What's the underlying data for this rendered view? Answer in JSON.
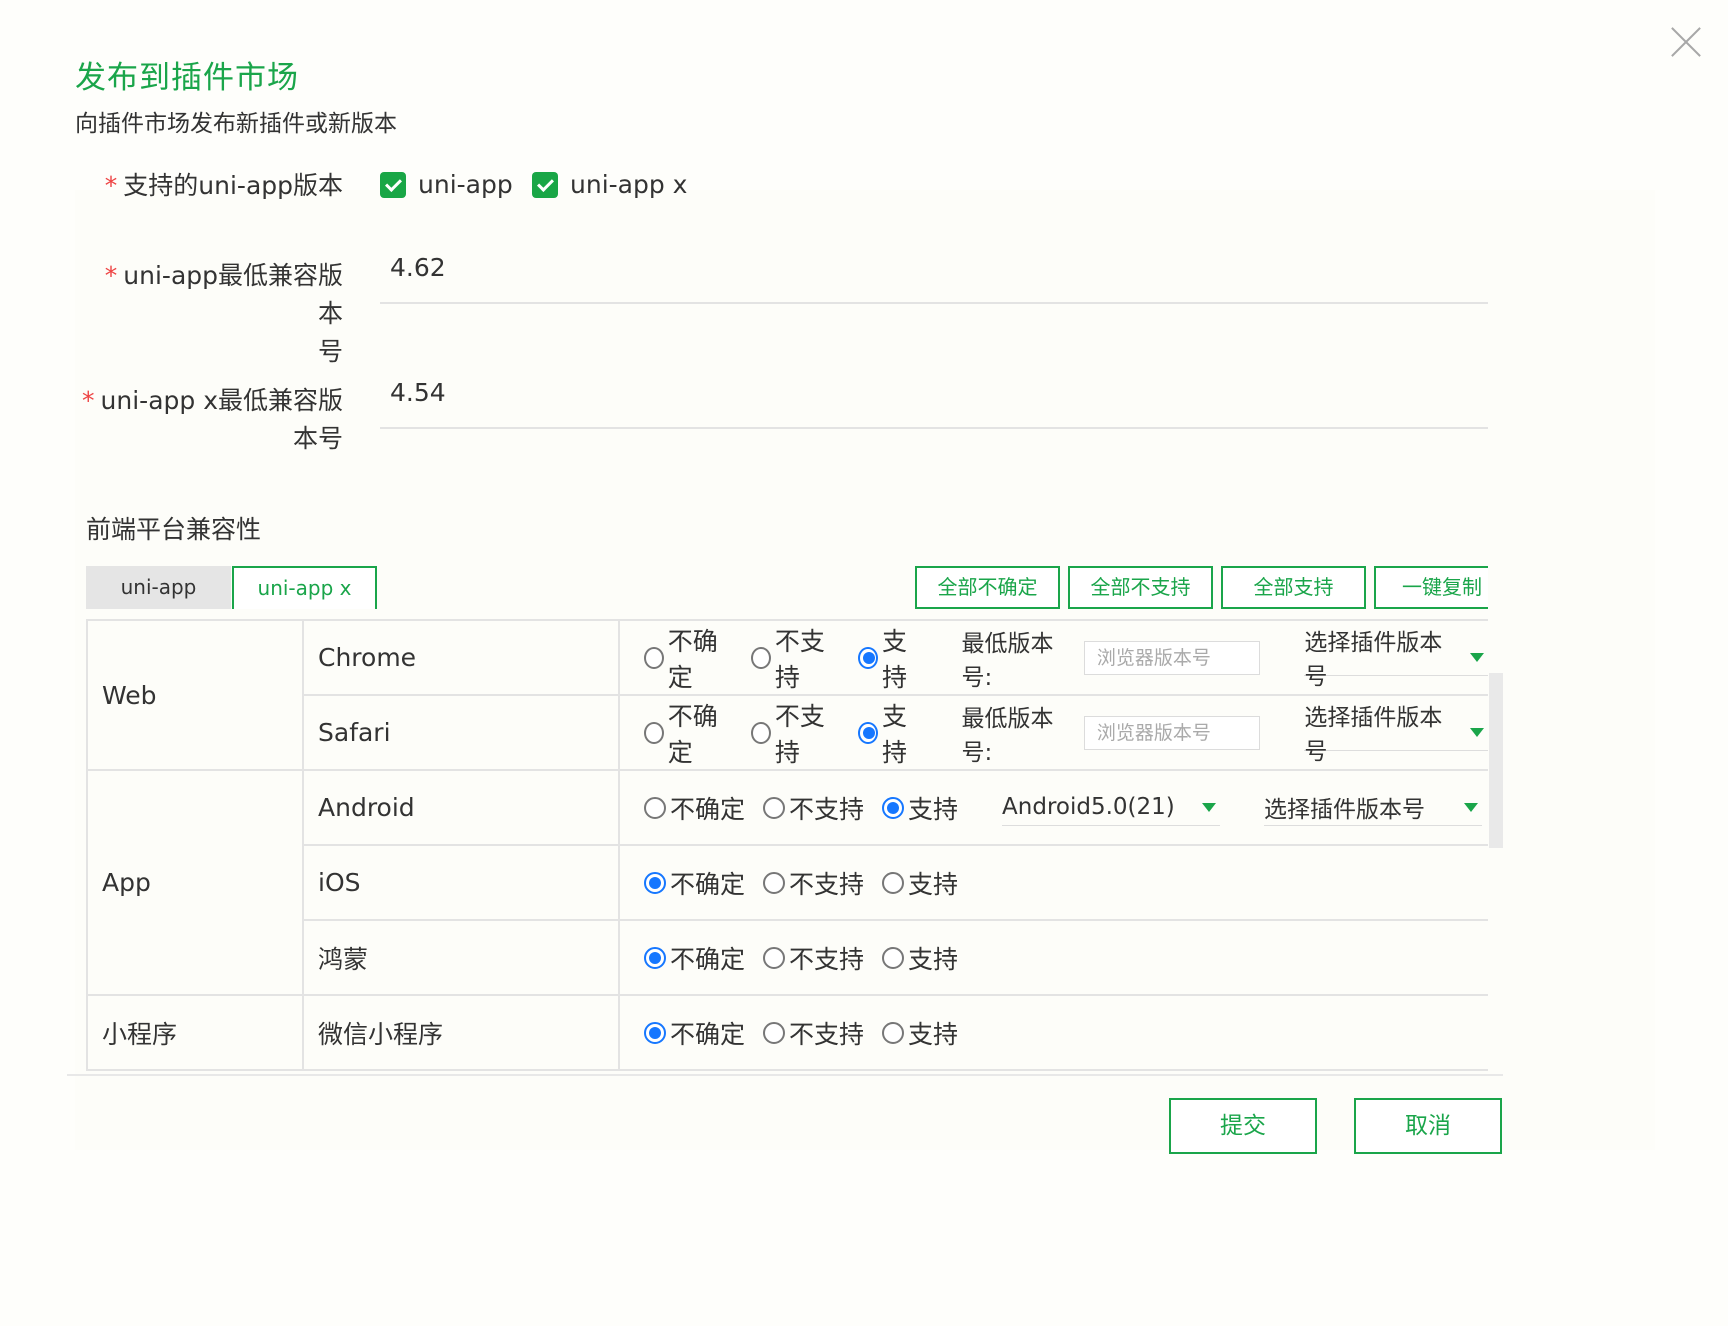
{
  "dialog": {
    "title": "发布到插件市场",
    "subtitle": "向插件市场发布新插件或新版本"
  },
  "form": {
    "supported_label": "支持的uni-app版本",
    "checkbox_uniapp": "uni-app",
    "checkbox_uniappx": "uni-app x",
    "min_uniapp_label_line1": "uni-app最低兼容版本",
    "min_uniapp_label_line2": "号",
    "min_uniapp_value": "4.62",
    "min_uniappx_label_line1": "uni-app x最低兼容版",
    "min_uniappx_label_line2": "本号",
    "min_uniappx_value": "4.54",
    "required_mark": "*"
  },
  "compat": {
    "section_title": "前端平台兼容性",
    "tabs": [
      "uni-app",
      "uni-app x"
    ],
    "actions": {
      "all_uncertain": "全部不确定",
      "all_unsupported": "全部不支持",
      "all_supported": "全部支持",
      "copy": "一键复制"
    },
    "options": [
      "不确定",
      "不支持",
      "支持"
    ],
    "min_version_label": "最低版本号:",
    "browser_version_placeholder": "浏览器版本号",
    "plugin_version_select": "选择插件版本号",
    "android_version": "Android5.0(21)",
    "groups": {
      "web": "Web",
      "app": "App",
      "mini": "小程序"
    },
    "platforms": {
      "chrome": "Chrome",
      "safari": "Safari",
      "android": "Android",
      "ios": "iOS",
      "harmony": "鸿蒙",
      "wechat": "微信小程序"
    }
  },
  "footer": {
    "submit": "提交",
    "cancel": "取消"
  },
  "colors": {
    "accent": "#1aa54a",
    "radio_selected": "#1677ff",
    "required": "#ee4444"
  }
}
